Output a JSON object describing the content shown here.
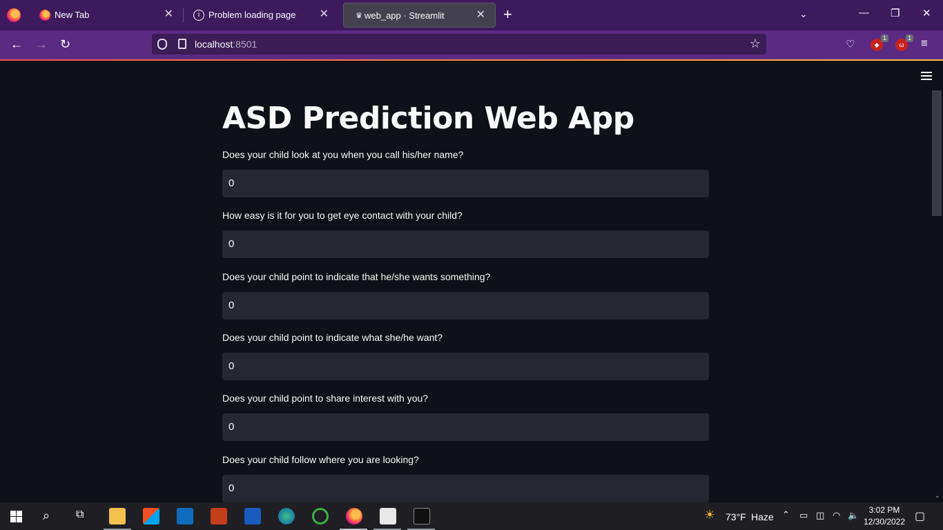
{
  "browser": {
    "tabs": [
      {
        "title": "New Tab",
        "active": false
      },
      {
        "title": "Problem loading page",
        "active": false
      },
      {
        "title": "web_app · Streamlit",
        "active": true
      }
    ],
    "url_host": "localhost",
    "url_port": ":8501",
    "extension_badges": [
      "1",
      "1"
    ]
  },
  "app": {
    "title": "ASD Prediction Web App",
    "fields": [
      {
        "label": "Does your child look at you when you call his/her name?",
        "value": "0"
      },
      {
        "label": "How easy is it for you to get eye contact with your child?",
        "value": "0"
      },
      {
        "label": "Does your child point to indicate that he/she wants something?",
        "value": "0"
      },
      {
        "label": "Does your child point to indicate what she/he want?",
        "value": "0"
      },
      {
        "label": "Does your child point to share interest with you?",
        "value": "0"
      },
      {
        "label": "Does your child follow where you are looking?",
        "value": "0"
      }
    ]
  },
  "taskbar": {
    "weather_temp": "73°F",
    "weather_desc": "Haze",
    "time": "3:02 PM",
    "date": "12/30/2022"
  },
  "colors": {
    "accent": "#ff4b4b",
    "tabbar_bg": "#3d1a5b",
    "navbar_bg": "#5a2a83",
    "app_bg": "#0e1117",
    "input_bg": "#262730"
  }
}
